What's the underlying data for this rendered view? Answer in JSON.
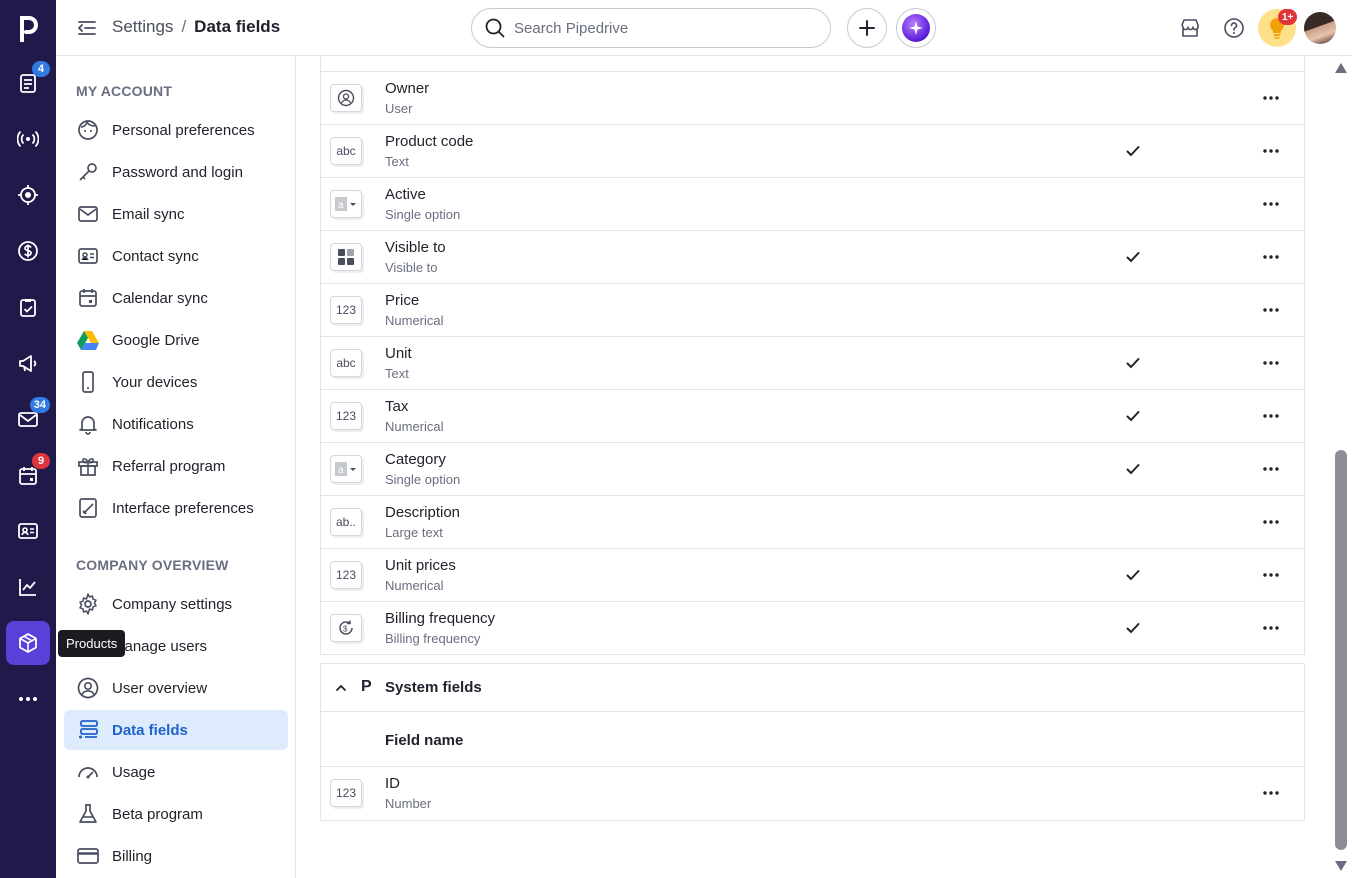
{
  "rail": {
    "logo": "p",
    "items": [
      {
        "icon": "leads-inbox-icon",
        "badge": "4"
      },
      {
        "icon": "activity-stream-icon",
        "badge": ""
      },
      {
        "icon": "focus-target-icon",
        "badge": ""
      },
      {
        "icon": "deals-dollar-icon",
        "badge": ""
      },
      {
        "icon": "activities-checklist-icon",
        "badge": ""
      },
      {
        "icon": "campaigns-megaphone-icon",
        "badge": ""
      },
      {
        "icon": "mail-icon",
        "badge": "34"
      },
      {
        "icon": "calendar-icon",
        "badge": "9"
      },
      {
        "icon": "contacts-card-icon",
        "badge": ""
      },
      {
        "icon": "insights-chart-icon",
        "badge": ""
      },
      {
        "icon": "products-box-icon",
        "badge": ""
      },
      {
        "icon": "more-dots-icon",
        "badge": ""
      }
    ],
    "tooltip": "Products"
  },
  "topbar": {
    "breadcrumb_parent": "Settings",
    "breadcrumb_sep": "/",
    "breadcrumb_current": "Data fields",
    "search_placeholder": "Search Pipedrive",
    "tips_badge": "1+"
  },
  "sidebar": {
    "my_account_heading": "MY ACCOUNT",
    "my_account": [
      {
        "label": "Personal preferences",
        "icon": "face-icon"
      },
      {
        "label": "Password and login",
        "icon": "key-icon"
      },
      {
        "label": "Email sync",
        "icon": "envelope-icon"
      },
      {
        "label": "Contact sync",
        "icon": "contact-card-icon"
      },
      {
        "label": "Calendar sync",
        "icon": "calendar-icon"
      },
      {
        "label": "Google Drive",
        "icon": "google-drive-icon"
      },
      {
        "label": "Your devices",
        "icon": "phone-icon"
      },
      {
        "label": "Notifications",
        "icon": "bell-icon"
      },
      {
        "label": "Referral program",
        "icon": "gift-icon"
      },
      {
        "label": "Interface preferences",
        "icon": "interface-edit-icon"
      }
    ],
    "company_heading": "COMPANY OVERVIEW",
    "company": [
      {
        "label": "Company settings",
        "icon": "gear-icon"
      },
      {
        "label": "Manage users",
        "icon": "users-icon"
      },
      {
        "label": "User overview",
        "icon": "user-circle-icon"
      },
      {
        "label": "Data fields",
        "icon": "data-fields-icon",
        "active": true
      },
      {
        "label": "Usage",
        "icon": "gauge-icon"
      },
      {
        "label": "Beta program",
        "icon": "flask-icon"
      },
      {
        "label": "Billing",
        "icon": "credit-card-icon"
      }
    ]
  },
  "fields": [
    {
      "name": "Owner",
      "type": "User",
      "icon_text": "",
      "icon": "user-field-icon",
      "checked": false
    },
    {
      "name": "Product code",
      "type": "Text",
      "icon_text": "abc",
      "icon": "text-field-icon",
      "checked": true
    },
    {
      "name": "Active",
      "type": "Single option",
      "icon_text": "",
      "icon": "single-option-icon",
      "checked": false
    },
    {
      "name": "Visible to",
      "type": "Visible to",
      "icon_text": "",
      "icon": "visibility-grid-icon",
      "checked": true
    },
    {
      "name": "Price",
      "type": "Numerical",
      "icon_text": "123",
      "icon": "numerical-field-icon",
      "checked": false
    },
    {
      "name": "Unit",
      "type": "Text",
      "icon_text": "abc",
      "icon": "text-field-icon",
      "checked": true
    },
    {
      "name": "Tax",
      "type": "Numerical",
      "icon_text": "123",
      "icon": "numerical-field-icon",
      "checked": true
    },
    {
      "name": "Category",
      "type": "Single option",
      "icon_text": "",
      "icon": "single-option-icon",
      "checked": true
    },
    {
      "name": "Description",
      "type": "Large text",
      "icon_text": "ab..",
      "icon": "large-text-field-icon",
      "checked": false
    },
    {
      "name": "Unit prices",
      "type": "Numerical",
      "icon_text": "123",
      "icon": "numerical-field-icon",
      "checked": true
    },
    {
      "name": "Billing frequency",
      "type": "Billing frequency",
      "icon_text": "",
      "icon": "billing-frequency-icon",
      "checked": true
    }
  ],
  "system": {
    "logo": "P",
    "title": "System fields",
    "column_header": "Field name",
    "fields": [
      {
        "name": "ID",
        "type": "Number",
        "icon_text": "123",
        "icon": "numerical-field-icon"
      }
    ]
  }
}
